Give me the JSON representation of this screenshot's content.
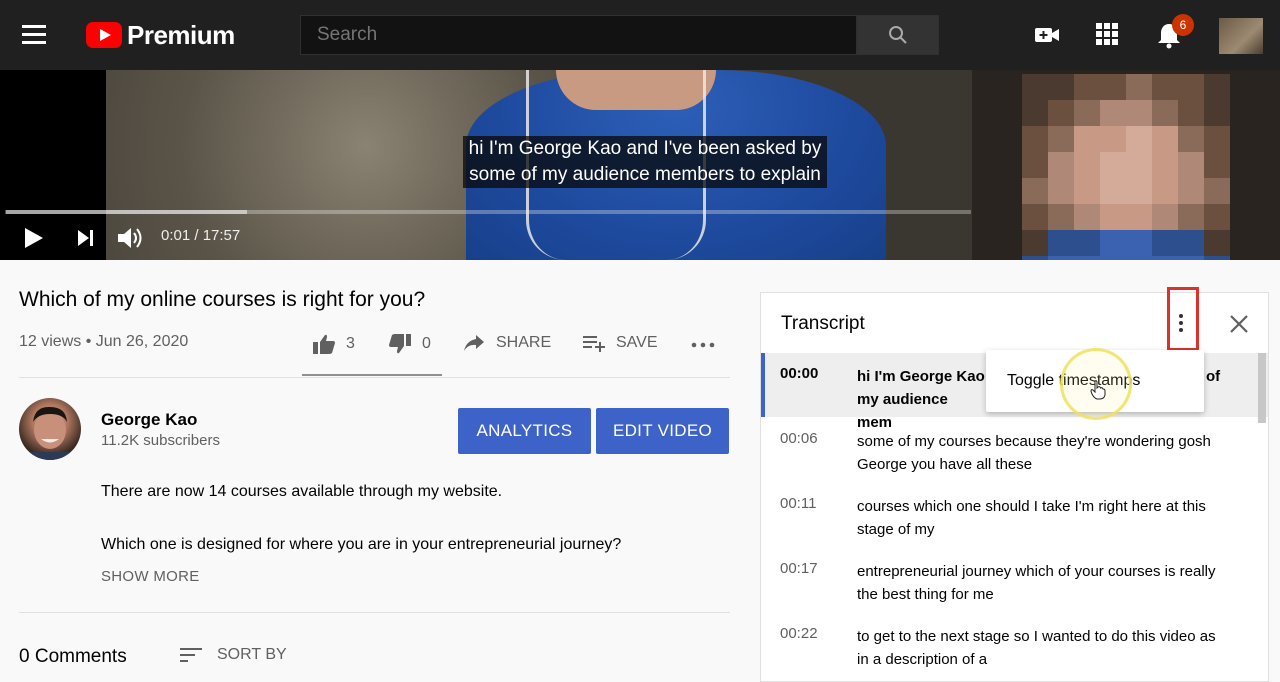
{
  "header": {
    "logo_text": "Premium",
    "search_placeholder": "Search",
    "notification_count": "6"
  },
  "player": {
    "caption_line1": "hi I'm George Kao and I've been asked by",
    "caption_line2": "some of my audience members to explain",
    "time_display": "0:01 / 17:57",
    "progress_fraction": 0.001
  },
  "video_info": {
    "title": "Which of my online courses is right for you?",
    "meta": "12 views • Jun 26, 2020",
    "likes": "3",
    "dislikes": "0",
    "share_label": "SHARE",
    "save_label": "SAVE"
  },
  "channel": {
    "name": "George Kao",
    "subscribers": "11.2K subscribers",
    "analytics_label": "ANALYTICS",
    "edit_label": "EDIT VIDEO"
  },
  "description": {
    "line1": "There are now 14 courses available through my website.",
    "line2": "Which one is designed for where you are in your entrepreneurial journey?",
    "show_more": "SHOW MORE"
  },
  "comments": {
    "count_label": "0 Comments",
    "sort_label": "SORT BY"
  },
  "transcript": {
    "title": "Transcript",
    "menu_item": "Toggle timestamps",
    "rows": [
      {
        "time": "00:00",
        "text_a": "hi I'm George Kao",
        "text_b": "of",
        "text_c": "my audience mem"
      },
      {
        "time": "00:06",
        "text": "some of my courses because they're wondering gosh George you have all these"
      },
      {
        "time": "00:11",
        "text": "courses which one should I take I'm right here at this stage of my"
      },
      {
        "time": "00:17",
        "text": "entrepreneurial journey which of your courses is really the best thing for me"
      },
      {
        "time": "00:22",
        "text": "to get to the next stage so I wanted to do this video as in a description of a"
      }
    ]
  },
  "colors": {
    "accent_blue": "#3d63c9",
    "highlight_red": "#d9332b",
    "youtube_red": "#ff0000"
  }
}
